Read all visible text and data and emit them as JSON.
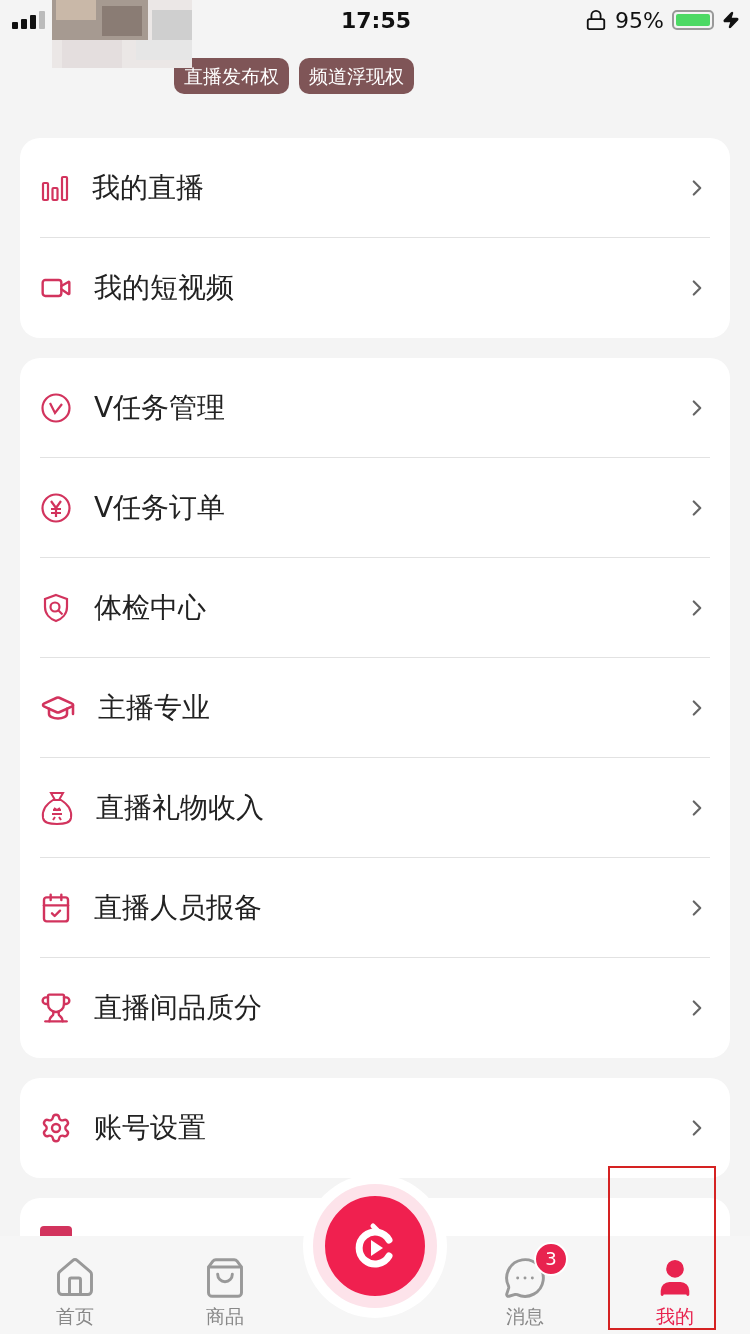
{
  "status_bar": {
    "time": "17:55",
    "battery_percent": "95%"
  },
  "profile": {
    "badges": [
      "直播发布权",
      "频道浮现权"
    ]
  },
  "menu_groups": [
    {
      "items": [
        "我的直播",
        "我的短视频"
      ]
    },
    {
      "items": [
        "V任务管理",
        "V任务订单",
        "体检中心",
        "主播专业",
        "直播礼物收入",
        "直播人员报备",
        "直播间品质分"
      ]
    },
    {
      "items": [
        "账号设置"
      ]
    }
  ],
  "tab_bar": {
    "tabs": [
      {
        "kind": "tab",
        "label": "首页",
        "selected": false
      },
      {
        "kind": "tab",
        "label": "商品",
        "selected": false
      },
      {
        "kind": "center"
      },
      {
        "kind": "tab",
        "label": "消息",
        "selected": false,
        "badge": "3"
      },
      {
        "kind": "tab",
        "label": "我的",
        "selected": true
      }
    ]
  }
}
